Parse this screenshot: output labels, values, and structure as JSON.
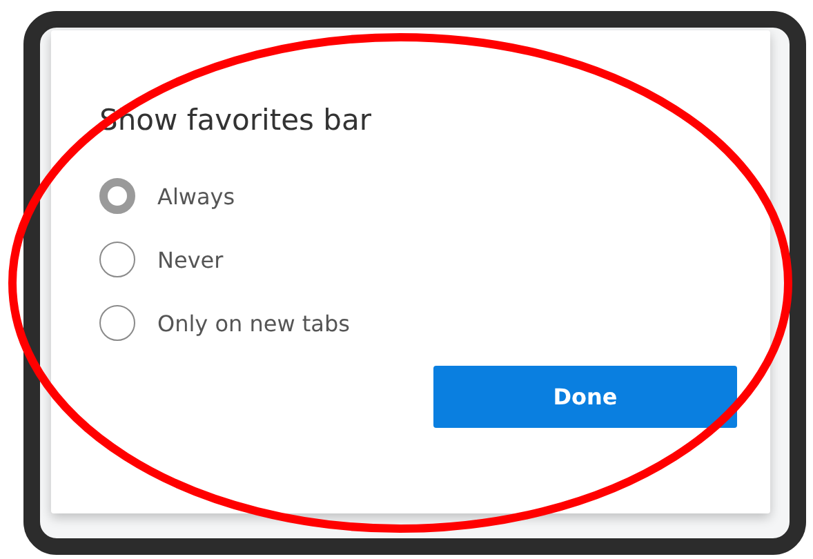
{
  "dialog": {
    "title": "Show favorites bar",
    "options": [
      {
        "label": "Always",
        "selected": true
      },
      {
        "label": "Never",
        "selected": false
      },
      {
        "label": "Only on new tabs",
        "selected": false
      }
    ],
    "button": "Done"
  }
}
